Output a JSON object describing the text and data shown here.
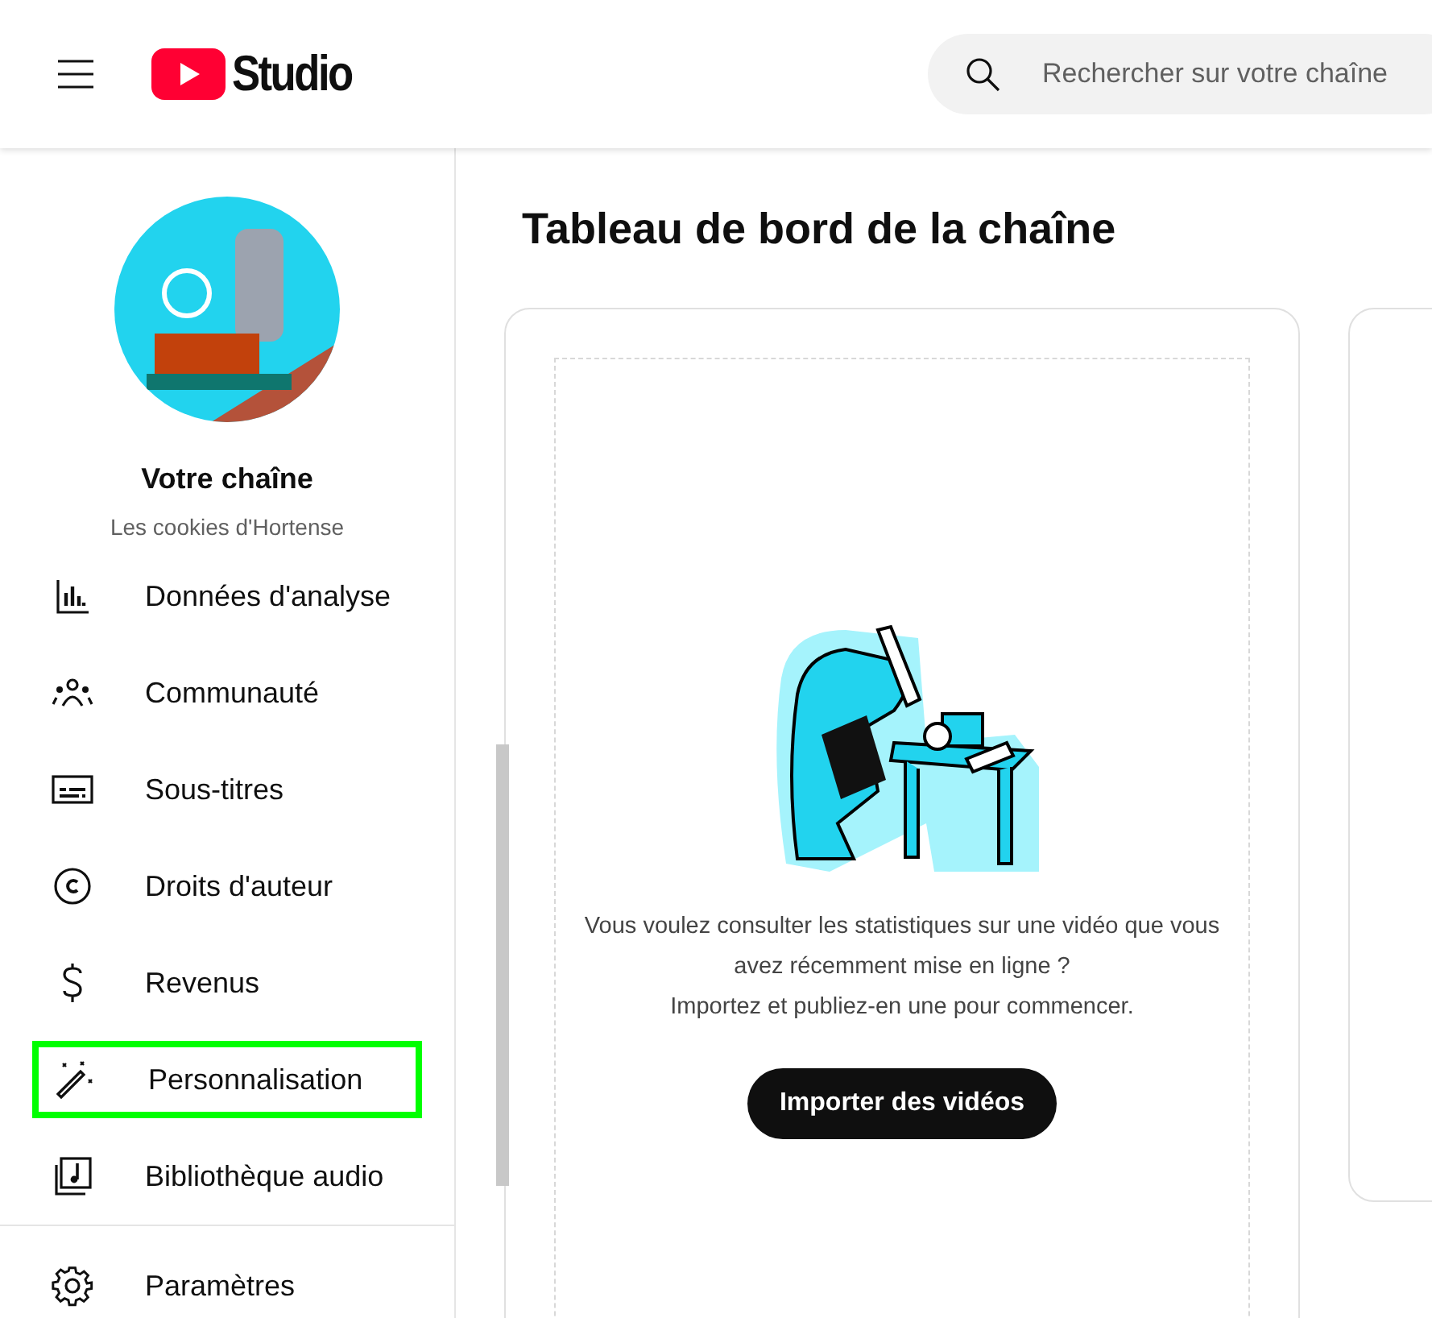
{
  "header": {
    "logo_text": "Studio",
    "search": {
      "placeholder": "Rechercher sur votre chaîne"
    }
  },
  "channel": {
    "heading": "Votre chaîne",
    "name": "Les cookies d'Hortense"
  },
  "sidebar": {
    "items": [
      {
        "label": "Données d'analyse",
        "highlighted": false
      },
      {
        "label": "Communauté",
        "highlighted": false
      },
      {
        "label": "Sous-titres",
        "highlighted": false
      },
      {
        "label": "Droits d'auteur",
        "highlighted": false
      },
      {
        "label": "Revenus",
        "highlighted": false
      },
      {
        "label": "Personnalisation",
        "highlighted": true
      },
      {
        "label": "Bibliothèque audio",
        "highlighted": false
      }
    ],
    "footer_items": [
      {
        "label": "Paramètres"
      }
    ]
  },
  "main": {
    "title": "Tableau de bord de la chaîne",
    "upload_card": {
      "message": "Vous voulez consulter les statistiques sur une vidéo que vous avez récemment mise en ligne ?",
      "hint": "Importez et publiez-en une pour commencer.",
      "button": "Importer des vidéos"
    }
  }
}
